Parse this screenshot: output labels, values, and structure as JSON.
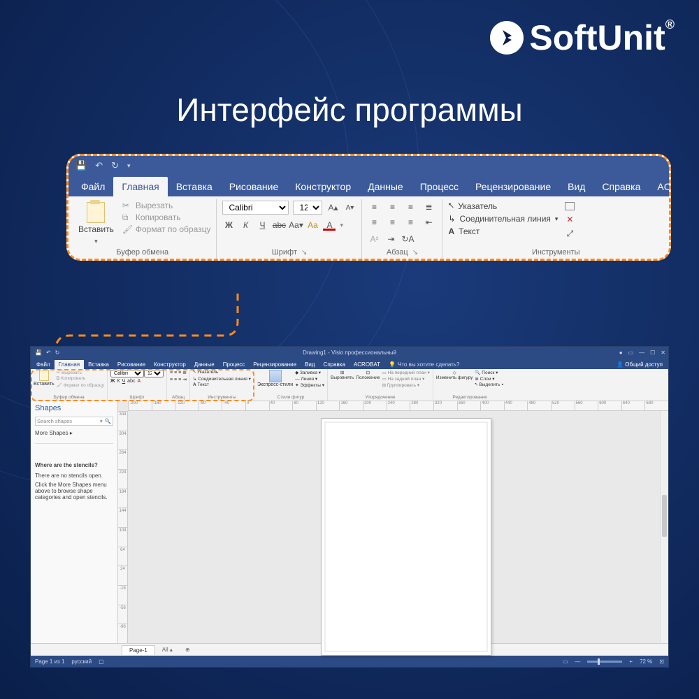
{
  "brand": {
    "name": "SoftUnit",
    "reg": "®"
  },
  "headline": "Интерфейс программы",
  "callout": {
    "tabs": [
      "Файл",
      "Главная",
      "Вставка",
      "Рисование",
      "Конструктор",
      "Данные",
      "Процесс",
      "Рецензирование",
      "Вид",
      "Справка",
      "ACROBAT"
    ],
    "active_tab_index": 1,
    "clipboard": {
      "paste": "Вставить",
      "cut": "Вырезать",
      "copy": "Копировать",
      "format_painter": "Формат по образцу",
      "group_label": "Буфер обмена"
    },
    "font": {
      "name": "Calibri",
      "size": "12pt",
      "group_label": "Шрифт",
      "case_label": "Aa",
      "sample": "Aa"
    },
    "paragraph": {
      "group_label": "Абзац"
    },
    "tools": {
      "pointer": "Указатель",
      "connector": "Соединительная линия",
      "text": "Текст",
      "group_label": "Инструменты"
    }
  },
  "app": {
    "title": "Drawing1 - Visio профессиональный",
    "tabs": [
      "Файл",
      "Главная",
      "Вставка",
      "Рисование",
      "Конструктор",
      "Данные",
      "Процесс",
      "Рецензирование",
      "Вид",
      "Справка",
      "ACROBAT"
    ],
    "tellme": "Что вы хотите сделать?",
    "share": "Общий доступ",
    "ribbon": {
      "clipboard": {
        "paste": "Вставить",
        "cut": "Вырезать",
        "copy": "Копировать",
        "painter": "Формат по образцу",
        "label": "Буфер обмена"
      },
      "font": {
        "name": "Calibri",
        "size": "12pt",
        "label": "Шрифт"
      },
      "paragraph_label": "Абзац",
      "tools": {
        "pointer": "Указатель",
        "connector": "Соединительная линия",
        "text": "Текст",
        "label": "Инструменты"
      },
      "shape_styles": {
        "fill": "Заливка",
        "line": "Линия",
        "effects": "Эффекты",
        "express": "Экспресс-стили",
        "label": "Стили фигур"
      },
      "arrange": {
        "align": "Выровнять",
        "position": "Положение",
        "front": "На передний план",
        "back": "На задний план",
        "group": "Группировать",
        "label": "Упорядочение"
      },
      "editing": {
        "change": "Изменить фигуру",
        "find": "Поиск",
        "layers": "Слои",
        "select": "Выделить",
        "label": "Редактирование"
      }
    },
    "shapes_pane": {
      "title": "Shapes",
      "search_placeholder": "Search shapes",
      "more": "More Shapes",
      "q": "Where are the stencils?",
      "msg1": "There are no stencils open.",
      "msg2": "Click the More Shapes menu above to browse shape categories and open stencils."
    },
    "ruler_ticks_h": [
      "-200",
      "-160",
      "-120",
      "-80",
      "-40",
      "0",
      "40",
      "80",
      "120",
      "160",
      "200",
      "240",
      "280",
      "320",
      "360",
      "400",
      "440",
      "480",
      "520",
      "560",
      "600",
      "640",
      "680"
    ],
    "ruler_ticks_v": [
      "344",
      "304",
      "264",
      "224",
      "184",
      "144",
      "104",
      "64",
      "24",
      "-16",
      "-56",
      "-96"
    ],
    "page_tabs": {
      "page1": "Page-1",
      "all": "All"
    },
    "status": {
      "page": "Page 1 из 1",
      "lang": "русский",
      "zoom": "72 %"
    }
  }
}
